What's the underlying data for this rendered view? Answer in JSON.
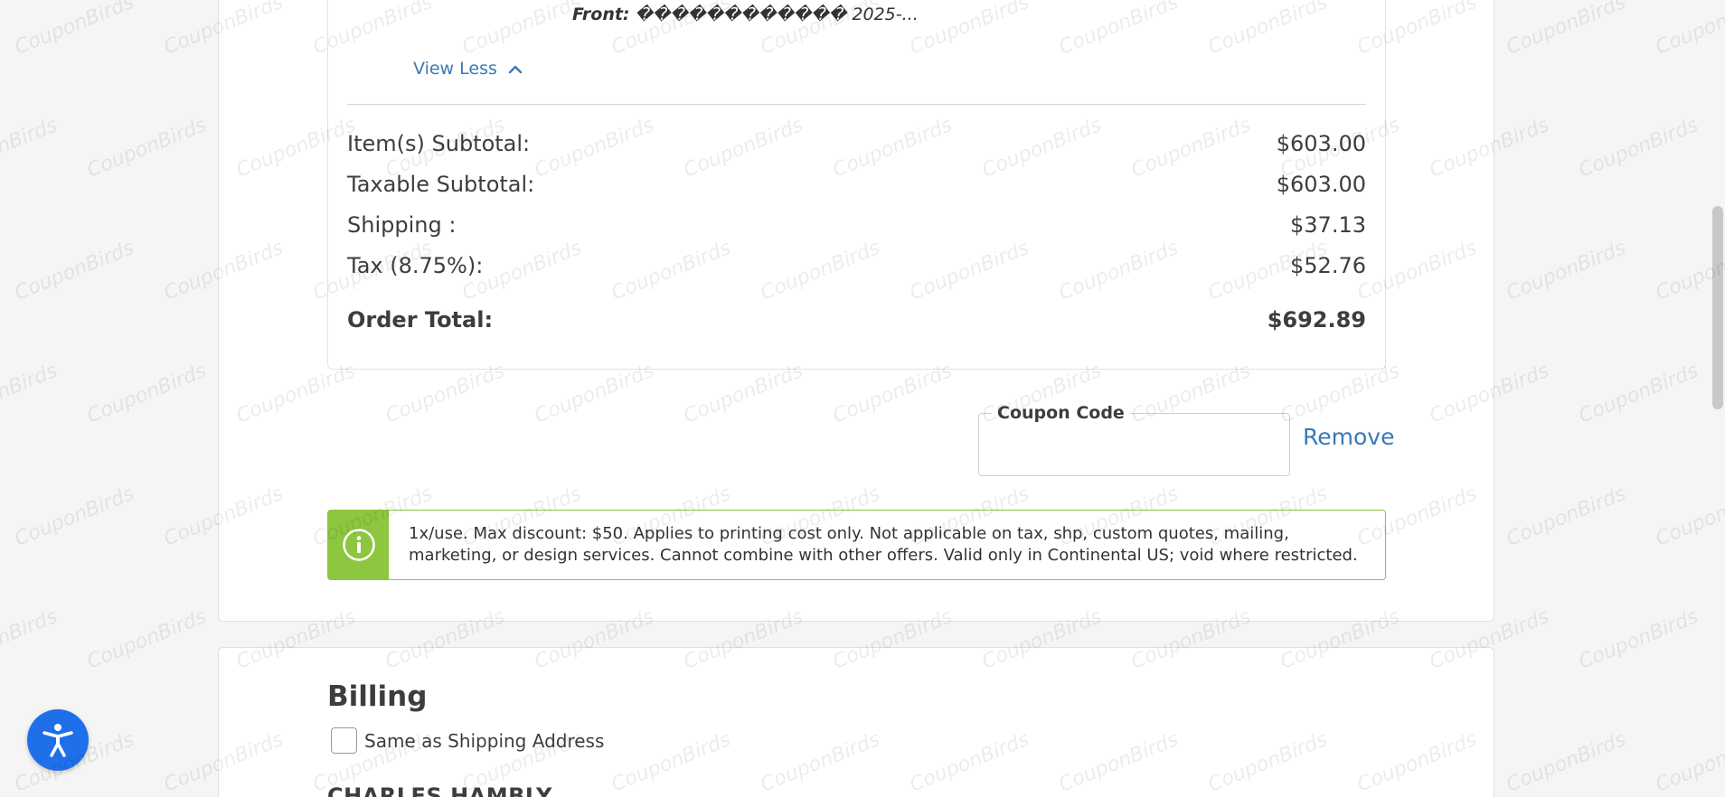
{
  "summary": {
    "front_label": "Front:",
    "front_value": "������������ 2025-...",
    "view_less": "View Less",
    "rows": [
      {
        "label": "Item(s) Subtotal:",
        "value": "$603.00"
      },
      {
        "label": "Taxable Subtotal:",
        "value": "$603.00"
      },
      {
        "label": "Shipping :",
        "value": "$37.13"
      },
      {
        "label": "Tax (8.75%):",
        "value": "$52.76"
      }
    ],
    "total": {
      "label": "Order Total:",
      "value": "$692.89"
    }
  },
  "coupon": {
    "label": "Coupon Code",
    "value": "",
    "remove": "Remove"
  },
  "notice": {
    "text": "1x/use. Max discount: $50. Applies to printing cost only. Not applicable on tax, shp, custom quotes, mailing, marketing, or design services. Cannot combine with other offers. Valid only in Continental US; void where restricted."
  },
  "billing": {
    "title": "Billing",
    "same_as_shipping": "Same as Shipping Address",
    "name": "CHARLES HAMBLY"
  },
  "watermark": {
    "text": "CouponBirds"
  },
  "icons": {
    "view_less": "chevron-up-icon",
    "notice": "info-icon",
    "accessibility": "accessibility-icon"
  },
  "colors": {
    "link": "#3a78b8",
    "notice_accent": "#8dc63f",
    "accessibility": "#1f6feb"
  }
}
